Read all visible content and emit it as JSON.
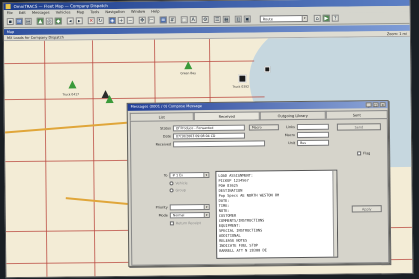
{
  "app": {
    "title": "OmniTRACS — Fleet Map — Company Dispatch",
    "menus": [
      "File",
      "Edit",
      "Messages",
      "Vehicles",
      "Map",
      "Tools",
      "Navigation",
      "Window",
      "Help"
    ]
  },
  "toolbar": {
    "zoom_combo_value": "Route"
  },
  "map_window": {
    "title": "Map",
    "status": "MX Loads for Company Dispatch",
    "zoom_readout": "Zoom: 1 mi"
  },
  "markers": [
    {
      "label": "Truck 0417"
    },
    {
      "label": "Truck 0392"
    },
    {
      "label": "Green Bay"
    }
  ],
  "dialog": {
    "title": "Messages (0001 / 0) Compose Message",
    "tabs": [
      "List",
      "Received",
      "Outgoing Library",
      "Sent"
    ],
    "status_label": "Status",
    "status_value": "Of Produce - Forwarded",
    "date_label": "Date",
    "date_value": "07/10/2003 09:08:04 CD",
    "received_label": "Received",
    "received_value": "",
    "macro_label": "Macro",
    "macro_value": "",
    "links_label": "Links",
    "links_value": "",
    "unit_label": "Unit",
    "unit_value": "Bus",
    "send_button": "Send",
    "flag_label": "Flag",
    "to_label": "To",
    "to_value": "# 1 Ex",
    "vehicle_label": "Vehicle",
    "group_label": "Group",
    "priority_label": "Priority",
    "priority_value": "",
    "mode_label": "Mode",
    "mode_value": "Normal",
    "return_receipt_label": "Return Receipt",
    "apply_button": "Apply",
    "message_lines": [
      "LOAD ASSIGNMENT:",
      "PICKUP 1234567",
      "PO# 83625",
      "DESTINATION",
      "Pop Specs AE NORTH WESTON OH",
      "DATE: ",
      "TIME: ",
      "NOTE:",
      "CUSTOMER",
      "COMMENTS/INSTRUCTIONS",
      "EQUIPMENT:",
      "SPECIAL INSTRUCTIONS",
      "ADDITIONAL",
      "RELEASE NOTES",
      "INDICATE FUEL STOP",
      "BARRELL ATT N 28300 DE"
    ]
  }
}
